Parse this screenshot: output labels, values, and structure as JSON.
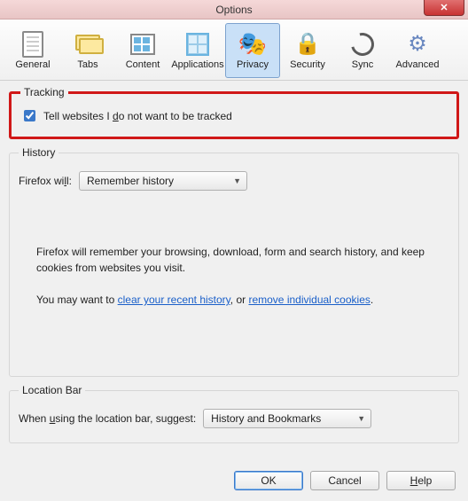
{
  "title": "Options",
  "tabs": {
    "general": "General",
    "tabs": "Tabs",
    "content": "Content",
    "applications": "Applications",
    "privacy": "Privacy",
    "security": "Security",
    "sync": "Sync",
    "advanced": "Advanced"
  },
  "tracking": {
    "legend": "Tracking",
    "dnt_prefix": "Tell websites I ",
    "dnt_u": "d",
    "dnt_suffix": "o not want to be tracked"
  },
  "history": {
    "legend": "History",
    "firefox_will_prefix": "Firefox wi",
    "firefox_will_u": "l",
    "firefox_will_suffix": "l:",
    "mode": "Remember history",
    "desc": "Firefox will remember your browsing, download, form and search history, and keep cookies from websites you visit.",
    "hint_prefix": "You may want to ",
    "link_clear": "clear your recent history",
    "hint_mid": ", or ",
    "link_cookies": "remove individual cookies",
    "hint_suffix": "."
  },
  "location": {
    "legend": "Location Bar",
    "label_prefix": "When ",
    "label_u": "u",
    "label_suffix": "sing the location bar, suggest:",
    "value": "History and Bookmarks"
  },
  "buttons": {
    "ok": "OK",
    "cancel": "Cancel",
    "help_u": "H",
    "help_rest": "elp"
  }
}
